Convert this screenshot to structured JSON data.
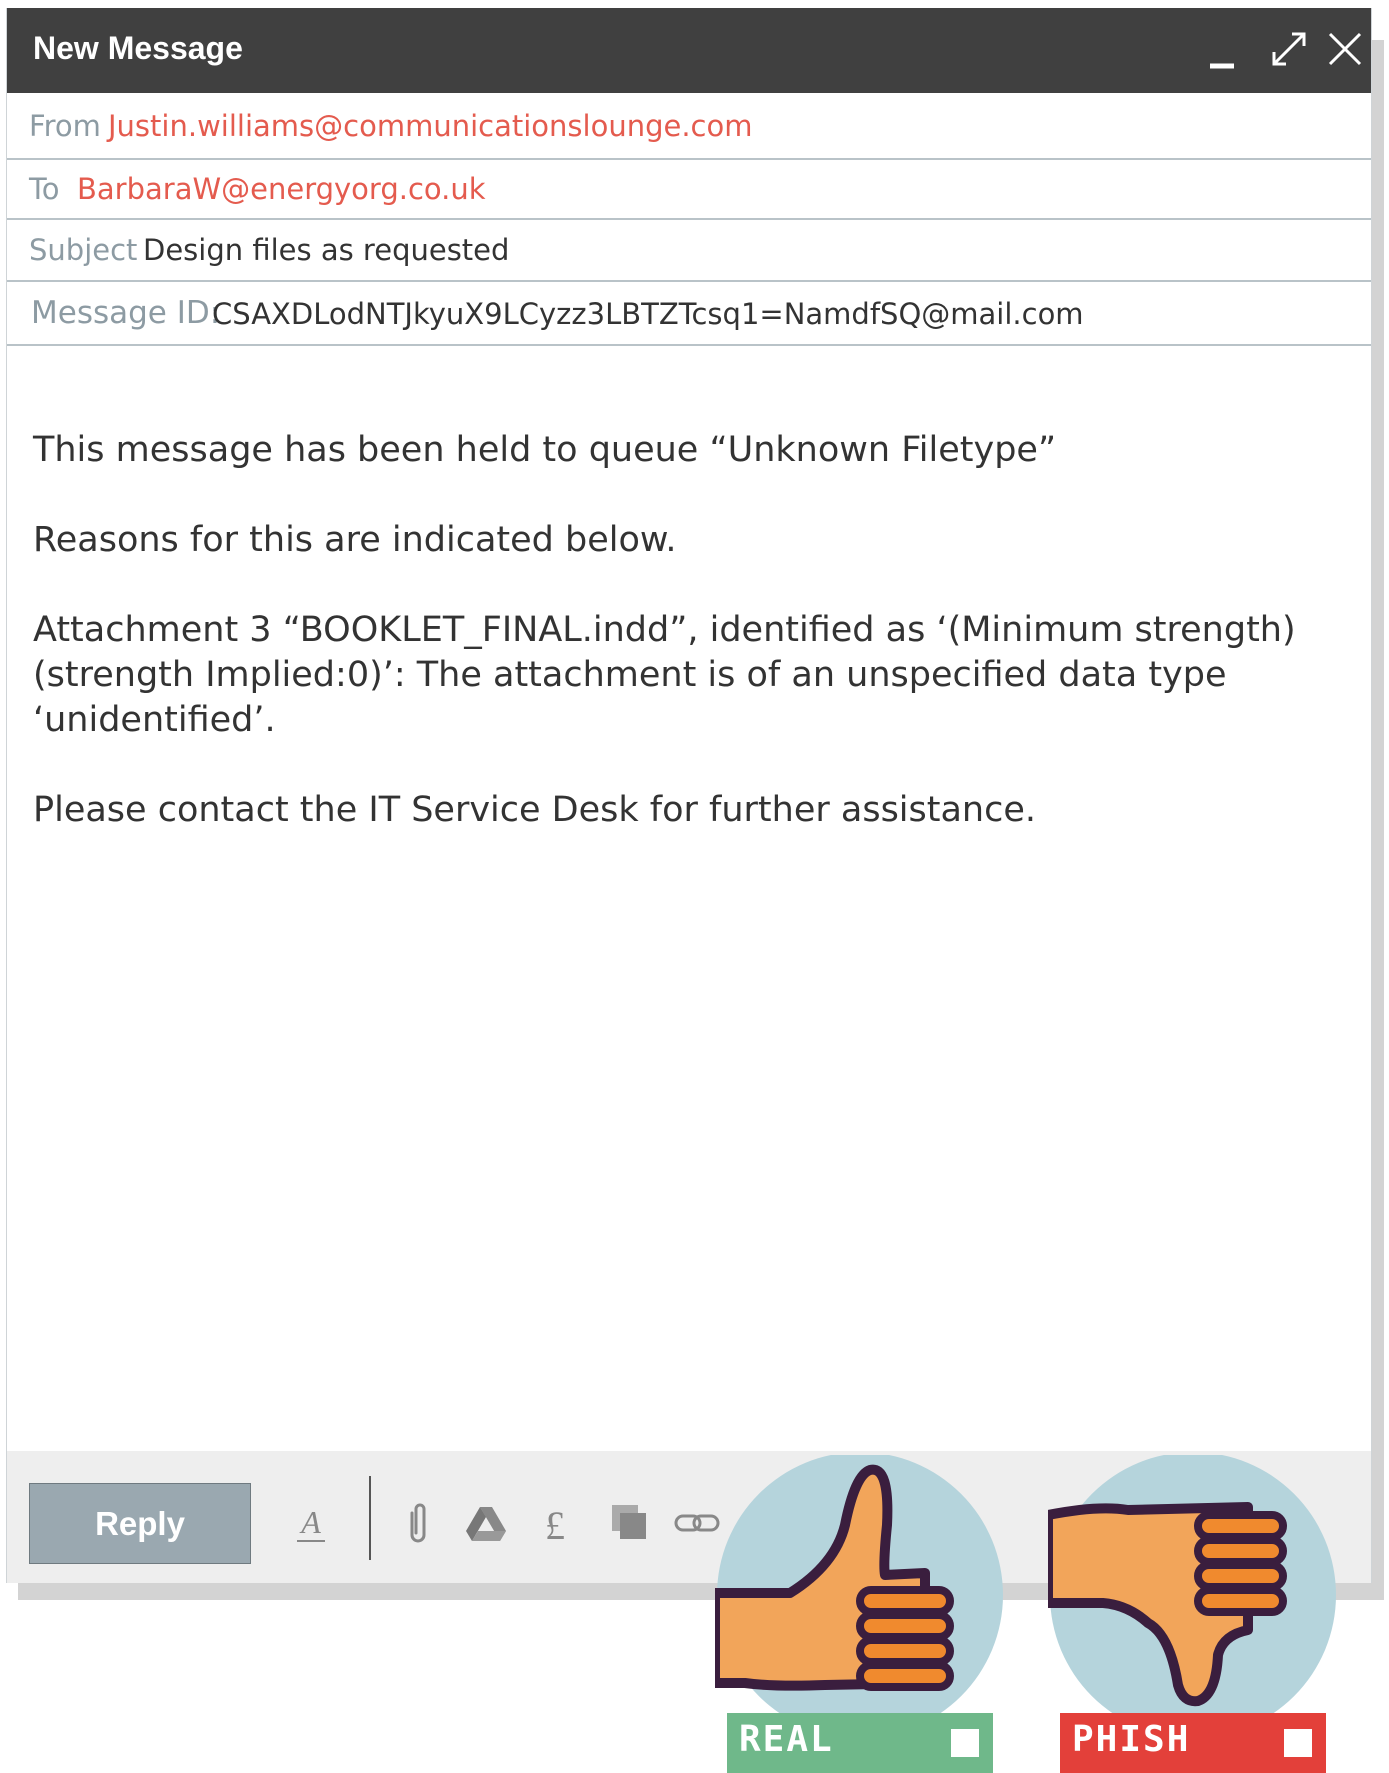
{
  "window": {
    "title": "New Message"
  },
  "header": {
    "from_label": "From",
    "from_value": "Justin.williams@communicationslounge.com",
    "to_label": "To",
    "to_value": "BarbaraW@energyorg.co.uk",
    "subject_label": "Subject",
    "subject_value": "Design files as requested",
    "message_id_label": "Message ID:",
    "message_id_value": "CSAXDLodNTJkyuX9LCyzz3LBTZTcsq1=NamdfSQ@mail.com"
  },
  "body": {
    "paragraphs": [
      "This message has been held to queue “Unknown Filetype”",
      "Reasons for this are indicated below.",
      "Attachment 3 “BOOKLET_FINAL.indd”, identified as ‘(Minimum strength) (strength Implied:0)’: The attachment is of an unspecified data type ‘unidentified’.",
      "Please contact the IT Service Desk for further assistance."
    ]
  },
  "toolbar": {
    "reply_label": "Reply",
    "icons": [
      "format-text-icon",
      "attach-icon",
      "drive-icon",
      "pound-icon",
      "copy-icon",
      "link-icon"
    ]
  },
  "vote": {
    "real_label": "REAL",
    "phish_label": "PHISH",
    "colors": {
      "real": "#6fb88a",
      "phish": "#e3403a",
      "circle": "#b5d4dc",
      "hand": "#f2a55a",
      "outline": "#3a1e3e"
    }
  }
}
